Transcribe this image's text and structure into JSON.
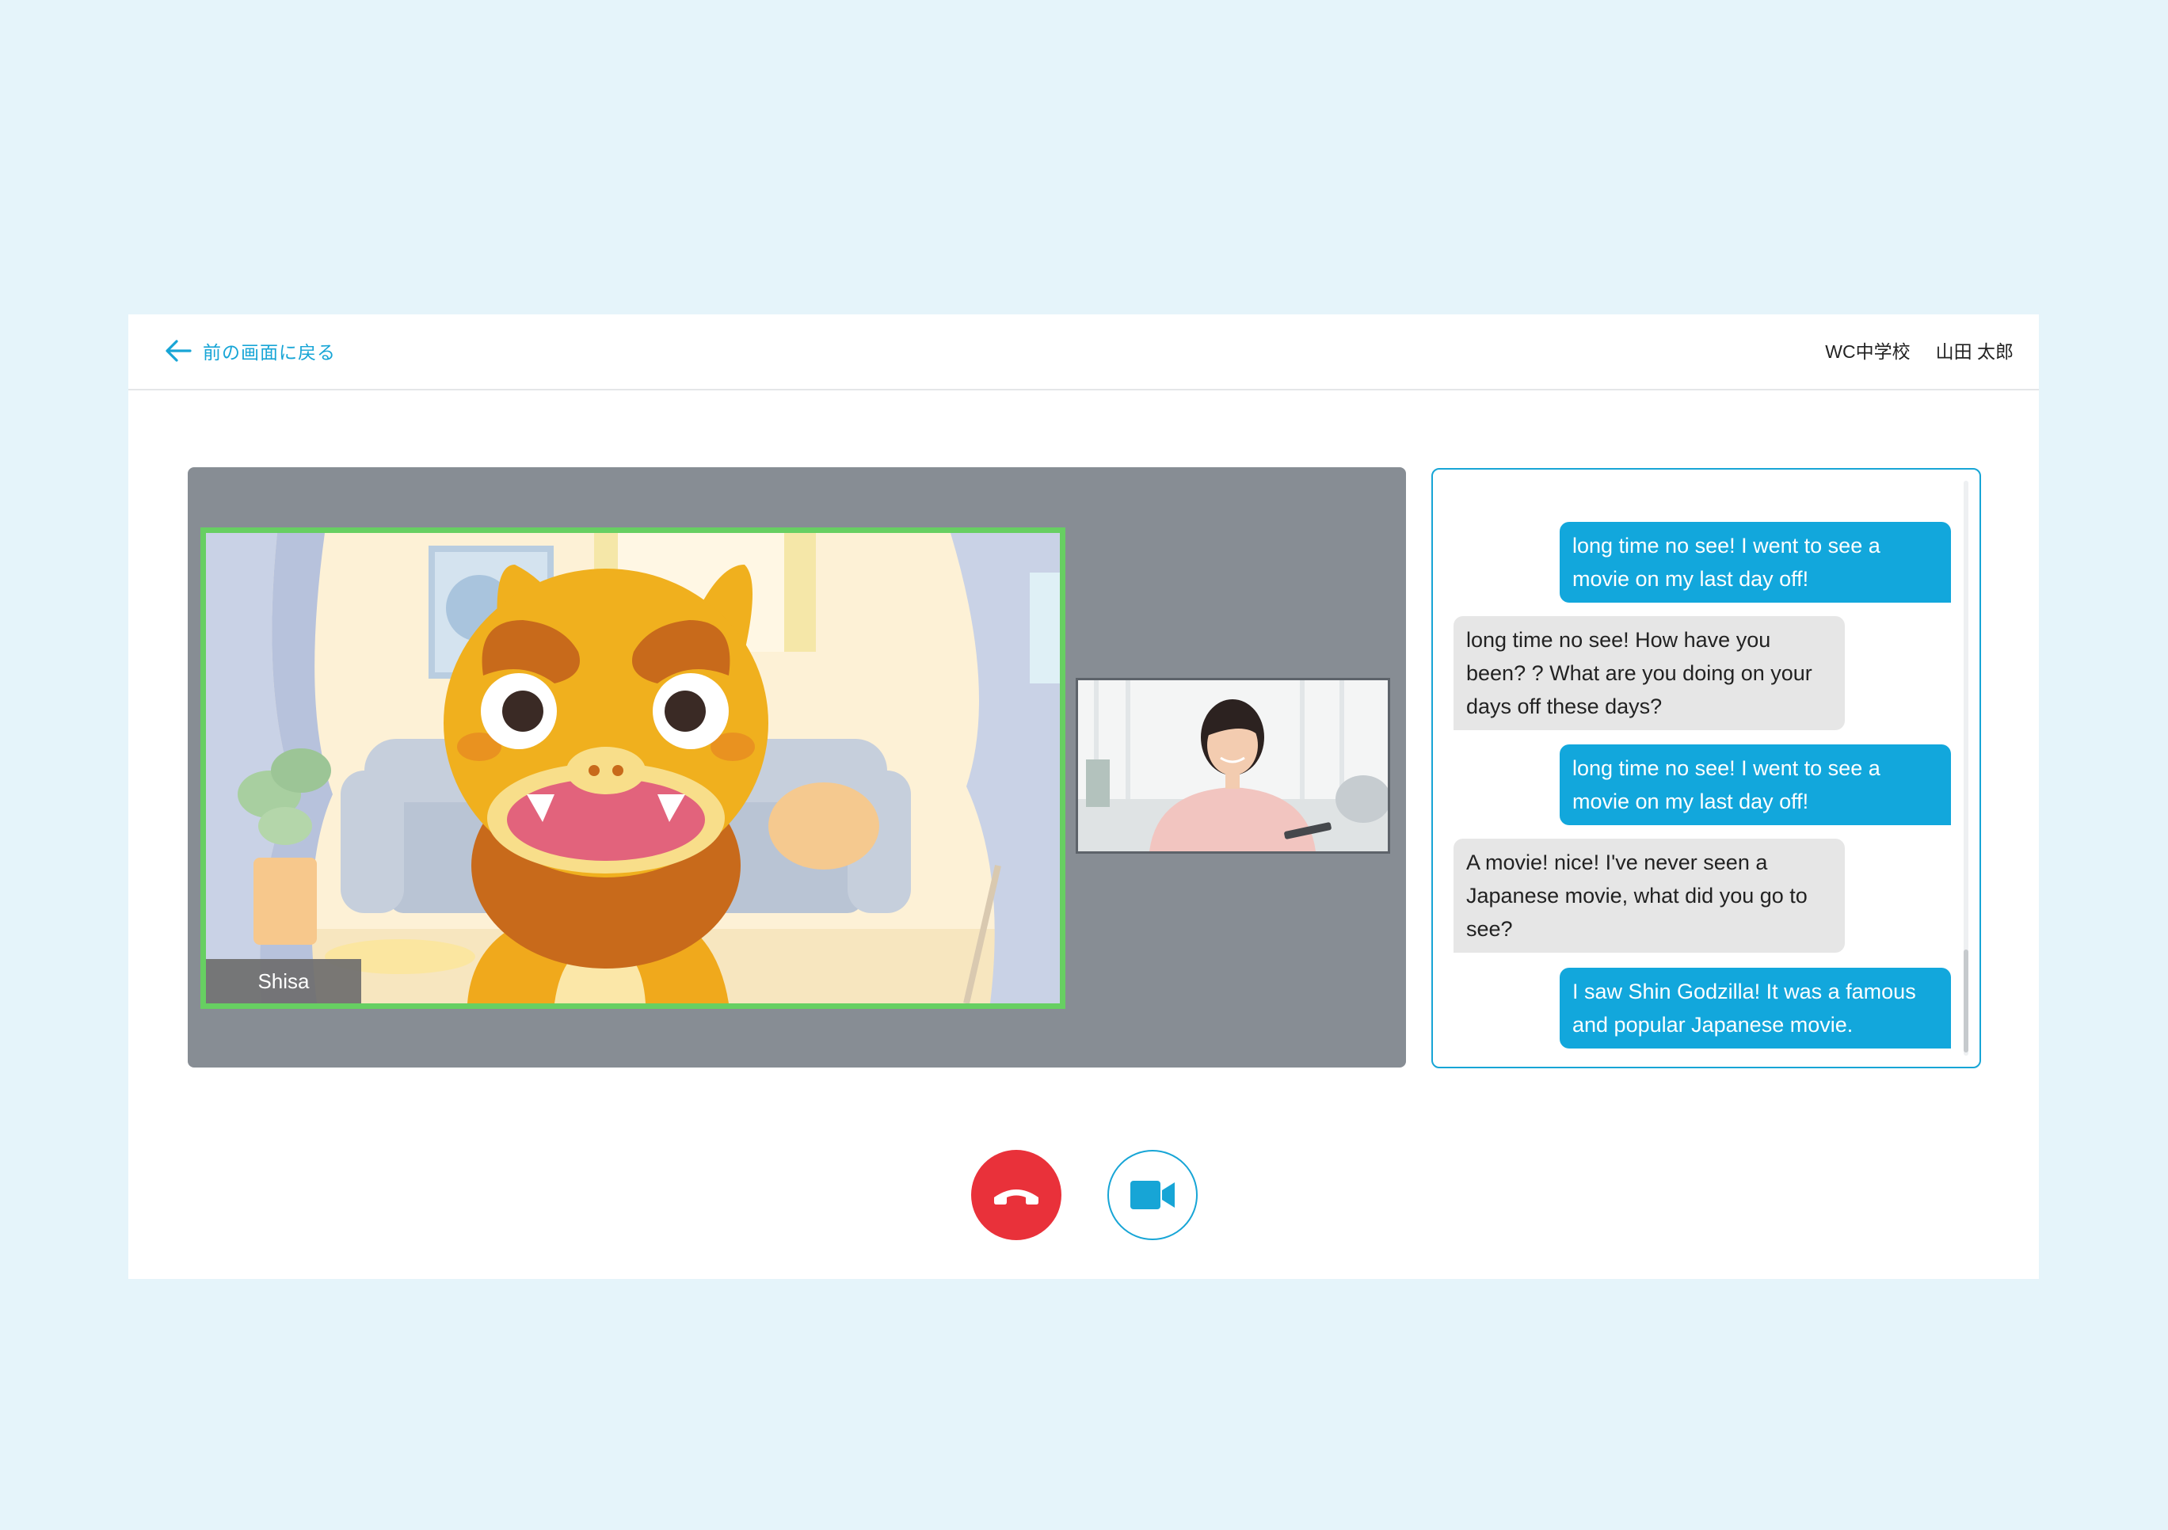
{
  "header": {
    "back_label": "前の画面に戻る",
    "school": "WC中学校",
    "user_name": "山田 太郎"
  },
  "video": {
    "main_participant_name": "Shisa",
    "active_speaker_border_color": "#67cf62"
  },
  "chat": {
    "messages": [
      {
        "side": "sent",
        "text": "long time no see! I went to see a movie on my last day off!"
      },
      {
        "side": "received",
        "text": "long time no see! How have you been? ? What are you doing on your days off these days?"
      },
      {
        "side": "sent",
        "text": "long time no see! I went to see a movie on my last day off!"
      },
      {
        "side": "received",
        "text": "A movie! nice! I've never seen a Japanese movie, what did you go to see?"
      },
      {
        "side": "sent",
        "text": "I saw Shin Godzilla! It was a famous and popular Japanese movie."
      }
    ]
  },
  "controls": {
    "end_call_icon": "phone-hangup-icon",
    "video_icon": "video-camera-icon"
  },
  "colors": {
    "accent": "#17a5d6",
    "end_call": "#e9313a",
    "sent_bubble": "#12a7dc",
    "received_bubble": "#e6e6e6",
    "page_background": "#e5f4fa"
  }
}
